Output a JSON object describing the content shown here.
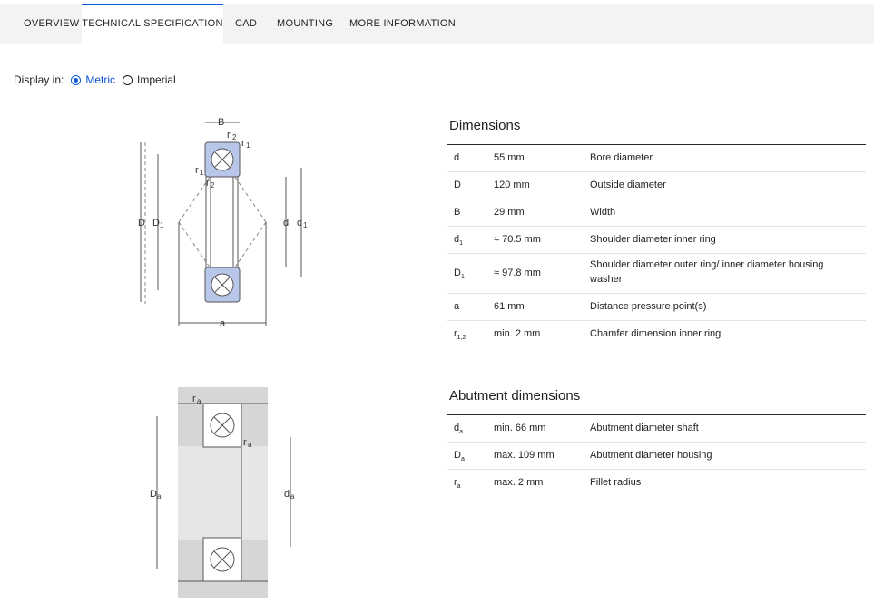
{
  "tabs": [
    {
      "label": "OVERVIEW",
      "active": false
    },
    {
      "label": "TECHNICAL SPECIFICATION",
      "active": true
    },
    {
      "label": "CAD",
      "active": false
    },
    {
      "label": "MOUNTING",
      "active": false
    },
    {
      "label": "MORE INFORMATION",
      "active": false
    }
  ],
  "units": {
    "label": "Display in:",
    "options": [
      {
        "label": "Metric",
        "selected": true
      },
      {
        "label": "Imperial",
        "selected": false
      }
    ]
  },
  "drawing1": {
    "labels": [
      "B",
      "r",
      "2",
      "r",
      "1",
      "r",
      "1",
      "r",
      "2",
      "D",
      "D",
      "1",
      "d",
      "d",
      "1",
      "a"
    ]
  },
  "drawing2": {
    "labels": [
      "r",
      "a",
      "r",
      "a",
      "D",
      "a",
      "d",
      "a"
    ]
  },
  "dimensions": {
    "title": "Dimensions",
    "rows": [
      {
        "sym": "d",
        "sub": "",
        "value": "55 mm",
        "desc": "Bore diameter"
      },
      {
        "sym": "D",
        "sub": "",
        "value": "120 mm",
        "desc": "Outside diameter"
      },
      {
        "sym": "B",
        "sub": "",
        "value": "29 mm",
        "desc": "Width"
      },
      {
        "sym": "d",
        "sub": "1",
        "value": "≈ 70.5 mm",
        "desc": "Shoulder diameter inner ring"
      },
      {
        "sym": "D",
        "sub": "1",
        "value": "≈ 97.8 mm",
        "desc": "Shoulder diameter outer ring/ inner diameter housing washer"
      },
      {
        "sym": "a",
        "sub": "",
        "value": "61 mm",
        "desc": "Distance pressure point(s)"
      },
      {
        "sym": "r",
        "sub": "1,2",
        "value": "min. 2 mm",
        "desc": "Chamfer dimension inner ring"
      }
    ]
  },
  "abutment": {
    "title": "Abutment dimensions",
    "rows": [
      {
        "sym": "d",
        "sub": "a",
        "value": "min. 66 mm",
        "desc": "Abutment diameter shaft"
      },
      {
        "sym": "D",
        "sub": "a",
        "value": "max. 109 mm",
        "desc": "Abutment diameter housing"
      },
      {
        "sym": "r",
        "sub": "a",
        "value": "max. 2 mm",
        "desc": "Fillet radius"
      }
    ]
  },
  "colors": {
    "accent": "#0f58d6",
    "ring_fill": "#b8c6ea",
    "housing_fill": "#d6d6d6"
  }
}
